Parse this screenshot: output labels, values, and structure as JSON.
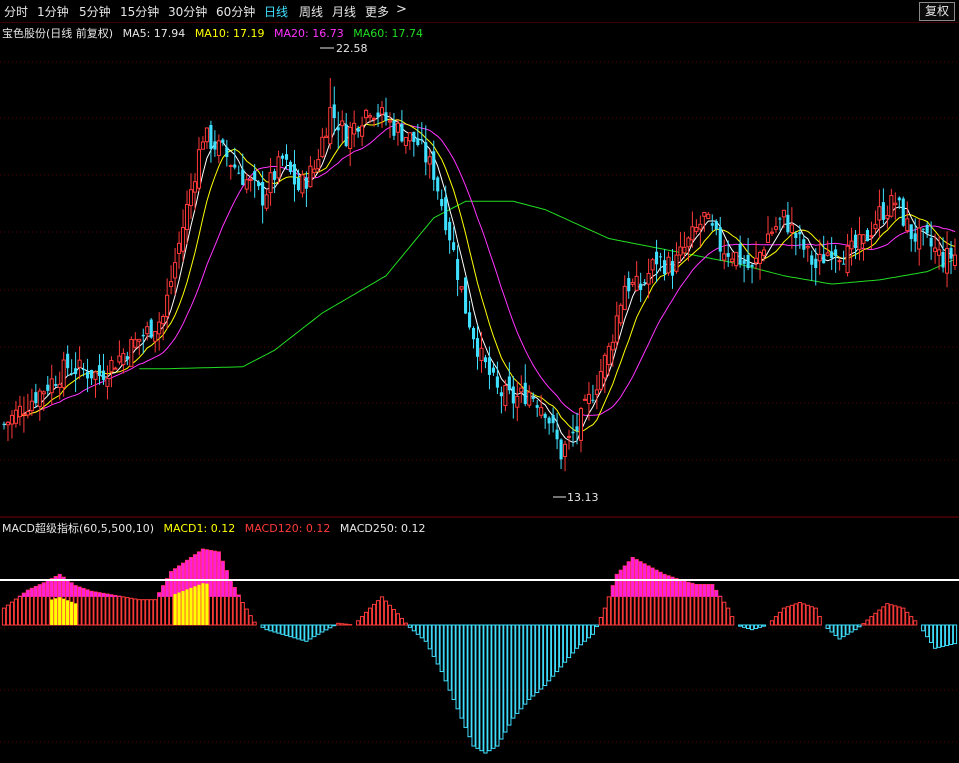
{
  "toolbar": {
    "tabs": [
      {
        "label": "分时",
        "active": false
      },
      {
        "label": "1分钟",
        "active": false
      },
      {
        "label": "5分钟",
        "active": false
      },
      {
        "label": "15分钟",
        "active": false
      },
      {
        "label": "30分钟",
        "active": false
      },
      {
        "label": "60分钟",
        "active": false
      },
      {
        "label": "日线",
        "active": true
      },
      {
        "label": "周线",
        "active": false
      },
      {
        "label": "月线",
        "active": false
      },
      {
        "label": "更多",
        "active": false
      }
    ],
    "more_arrow": ">",
    "fq_button": "复权"
  },
  "legend": {
    "stock": "宝色股份(日线 前复权)",
    "ma5": "MA5: 17.94",
    "ma10": "MA10: 17.19",
    "ma20": "MA20: 16.73",
    "ma60": "MA60: 17.74"
  },
  "macd_legend": {
    "title": "MACD超级指标(60,5,500,10)",
    "macd1": "MACD1: 0.12",
    "macd120": "MACD120: 0.12",
    "macd250": "MACD250: 0.12"
  },
  "colors": {
    "up": "#ff3a3a",
    "down": "#3fe0ff",
    "ma5": "#ffffff",
    "ma10": "#ffff00",
    "ma20": "#ff33ff",
    "ma60": "#22dd22",
    "macd_pos": "#ff3a3a",
    "macd_neg": "#3fe0ff",
    "macd_magenta": "#ff1fd8",
    "macd_yellow": "#ffff00",
    "grid": "#5a0000"
  },
  "chart_data": [
    {
      "type": "candlestick",
      "annotations": {
        "high": "22.58",
        "low": "13.13"
      },
      "ylim": [
        12.5,
        23.5
      ],
      "key_prices": [
        [
          0,
          14.2
        ],
        [
          8,
          14.9
        ],
        [
          16,
          15.6
        ],
        [
          24,
          15.4
        ],
        [
          32,
          16.1
        ],
        [
          40,
          16.8
        ],
        [
          45,
          19.0
        ],
        [
          50,
          21.2
        ],
        [
          55,
          20.8
        ],
        [
          60,
          20.2
        ],
        [
          65,
          19.7
        ],
        [
          70,
          20.6
        ],
        [
          74,
          19.9
        ],
        [
          78,
          20.4
        ],
        [
          82,
          21.8
        ],
        [
          86,
          21.2
        ],
        [
          92,
          21.9
        ],
        [
          98,
          21.4
        ],
        [
          104,
          21.0
        ],
        [
          108,
          20.3
        ],
        [
          112,
          18.8
        ],
        [
          116,
          17.0
        ],
        [
          120,
          15.8
        ],
        [
          124,
          15.0
        ],
        [
          128,
          14.8
        ],
        [
          132,
          15.0
        ],
        [
          136,
          14.6
        ],
        [
          140,
          13.5
        ],
        [
          144,
          14.1
        ],
        [
          148,
          15.0
        ],
        [
          152,
          16.0
        ],
        [
          156,
          17.6
        ],
        [
          160,
          17.5
        ],
        [
          164,
          18.2
        ],
        [
          168,
          18.0
        ],
        [
          172,
          18.6
        ],
        [
          176,
          19.2
        ],
        [
          180,
          18.5
        ],
        [
          184,
          18.3
        ],
        [
          188,
          17.9
        ],
        [
          192,
          18.8
        ],
        [
          196,
          19.2
        ],
        [
          200,
          18.6
        ],
        [
          204,
          18.0
        ],
        [
          208,
          18.5
        ],
        [
          212,
          18.3
        ],
        [
          216,
          18.6
        ],
        [
          220,
          19.3
        ],
        [
          224,
          19.6
        ],
        [
          228,
          18.8
        ],
        [
          232,
          18.6
        ],
        [
          236,
          18.2
        ],
        [
          239,
          18.3
        ]
      ],
      "ma60_curve": [
        [
          34,
          15.55
        ],
        [
          40,
          15.55
        ],
        [
          60,
          15.6
        ],
        [
          68,
          16.0
        ],
        [
          80,
          16.9
        ],
        [
          96,
          17.8
        ],
        [
          108,
          19.2
        ],
        [
          116,
          19.6
        ],
        [
          128,
          19.6
        ],
        [
          136,
          19.4
        ],
        [
          152,
          18.7
        ],
        [
          168,
          18.4
        ],
        [
          184,
          18.1
        ],
        [
          196,
          17.8
        ],
        [
          208,
          17.6
        ],
        [
          220,
          17.7
        ],
        [
          232,
          17.9
        ],
        [
          239,
          18.2
        ]
      ]
    },
    {
      "type": "bar",
      "zero_line": 0,
      "ylim": [
        -2.9,
        1.6
      ],
      "key_values": [
        [
          0,
          0.3
        ],
        [
          6,
          0.62
        ],
        [
          10,
          0.75
        ],
        [
          14,
          0.9
        ],
        [
          18,
          0.7
        ],
        [
          22,
          0.6
        ],
        [
          26,
          0.55
        ],
        [
          30,
          0.5
        ],
        [
          34,
          0.45
        ],
        [
          38,
          0.45
        ],
        [
          42,
          0.95
        ],
        [
          46,
          1.15
        ],
        [
          50,
          1.35
        ],
        [
          54,
          1.3
        ],
        [
          57,
          0.8
        ],
        [
          60,
          0.4
        ],
        [
          63,
          0.05
        ],
        [
          66,
          -0.1
        ],
        [
          72,
          -0.25
        ],
        [
          76,
          -0.35
        ],
        [
          80,
          -0.15
        ],
        [
          84,
          0.03
        ],
        [
          88,
          0.0
        ],
        [
          92,
          0.3
        ],
        [
          95,
          0.5
        ],
        [
          99,
          0.2
        ],
        [
          102,
          -0.05
        ],
        [
          106,
          -0.35
        ],
        [
          110,
          -1.0
        ],
        [
          114,
          -1.8
        ],
        [
          118,
          -2.6
        ],
        [
          121,
          -2.75
        ],
        [
          124,
          -2.6
        ],
        [
          128,
          -2.0
        ],
        [
          132,
          -1.6
        ],
        [
          136,
          -1.3
        ],
        [
          140,
          -0.9
        ],
        [
          144,
          -0.5
        ],
        [
          148,
          -0.2
        ],
        [
          151,
          0.3
        ],
        [
          154,
          0.9
        ],
        [
          158,
          1.2
        ],
        [
          162,
          1.05
        ],
        [
          166,
          0.9
        ],
        [
          170,
          0.8
        ],
        [
          174,
          0.72
        ],
        [
          178,
          0.72
        ],
        [
          182,
          0.3
        ],
        [
          184,
          0.0
        ],
        [
          188,
          -0.1
        ],
        [
          192,
          0.0
        ],
        [
          196,
          0.3
        ],
        [
          200,
          0.4
        ],
        [
          204,
          0.3
        ],
        [
          206,
          0.0
        ],
        [
          210,
          -0.3
        ],
        [
          214,
          -0.1
        ],
        [
          218,
          0.15
        ],
        [
          222,
          0.38
        ],
        [
          226,
          0.3
        ],
        [
          230,
          0.0
        ],
        [
          234,
          -0.5
        ],
        [
          239,
          -0.4
        ]
      ],
      "magenta_threshold": 0.5,
      "yellow_ranges": [
        [
          12,
          18
        ],
        [
          43,
          51
        ]
      ]
    }
  ]
}
